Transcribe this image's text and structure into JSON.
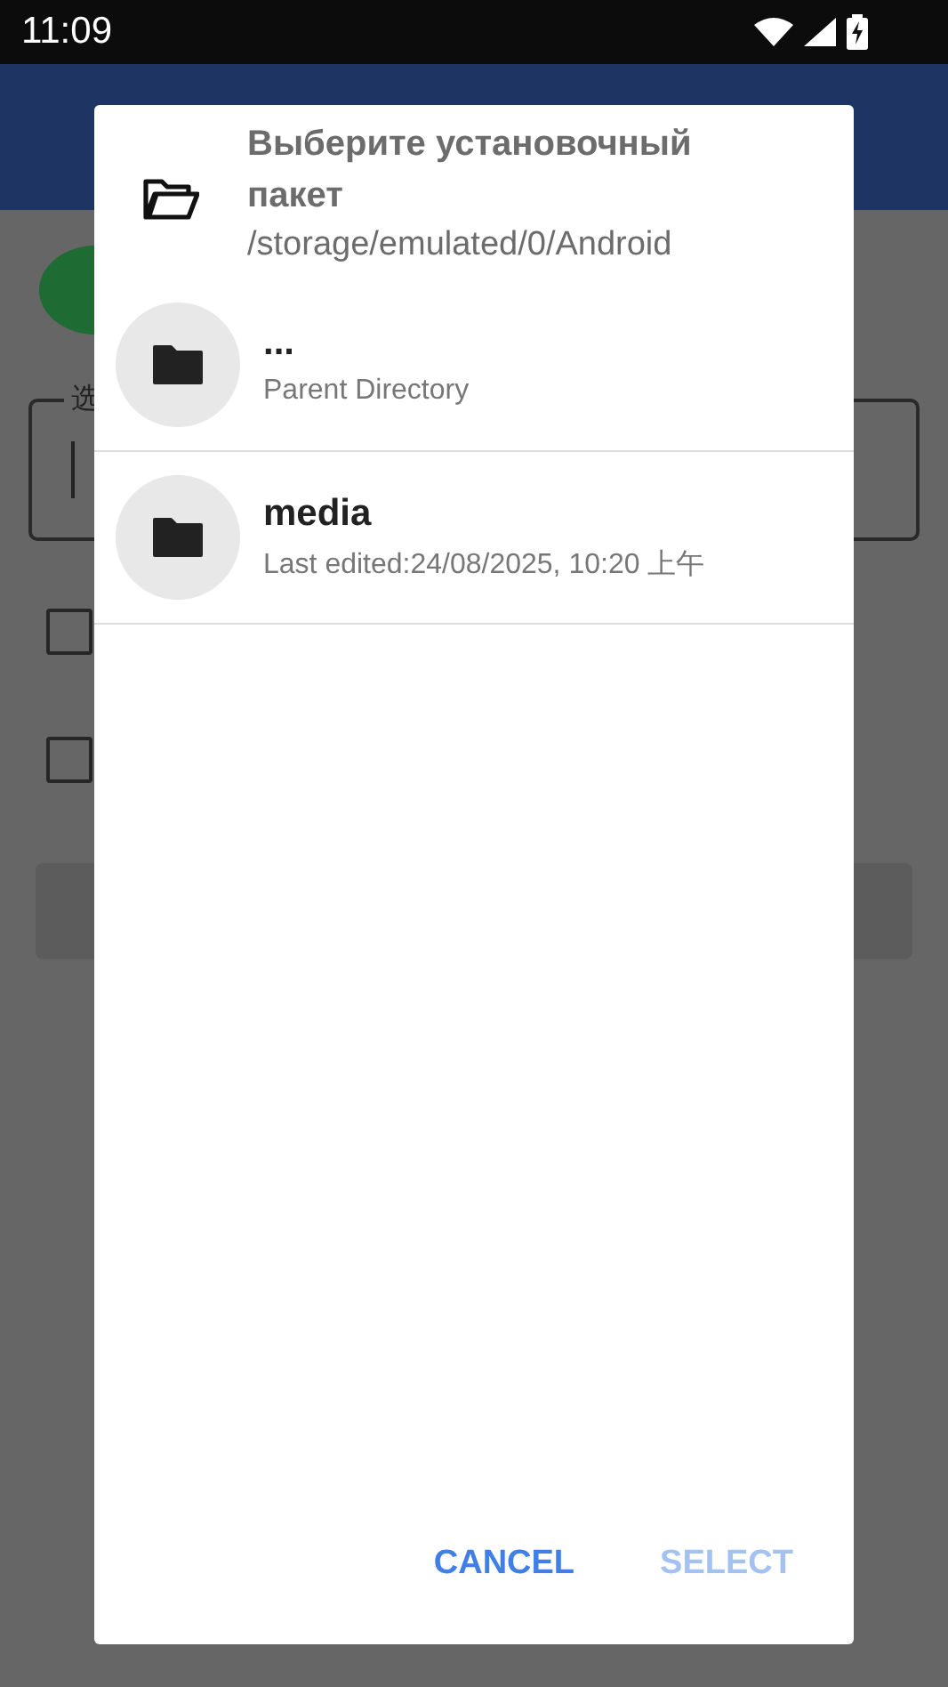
{
  "status_bar": {
    "time": "11:09"
  },
  "background": {
    "field": {
      "label": "选"
    },
    "checkboxes": [
      {
        "checked": false
      },
      {
        "checked": false
      }
    ]
  },
  "dialog": {
    "title": "Выберите установочный пакет",
    "path": "/storage/emulated/0/Android",
    "entries": [
      {
        "name": "...",
        "detail": "Parent Directory"
      },
      {
        "name": "media",
        "detail": "Last edited:24/08/2025, 10:20 上午"
      }
    ],
    "buttons": [
      {
        "label": "CANCEL",
        "disabled": false
      },
      {
        "label": "SELECT",
        "disabled": true
      }
    ]
  }
}
